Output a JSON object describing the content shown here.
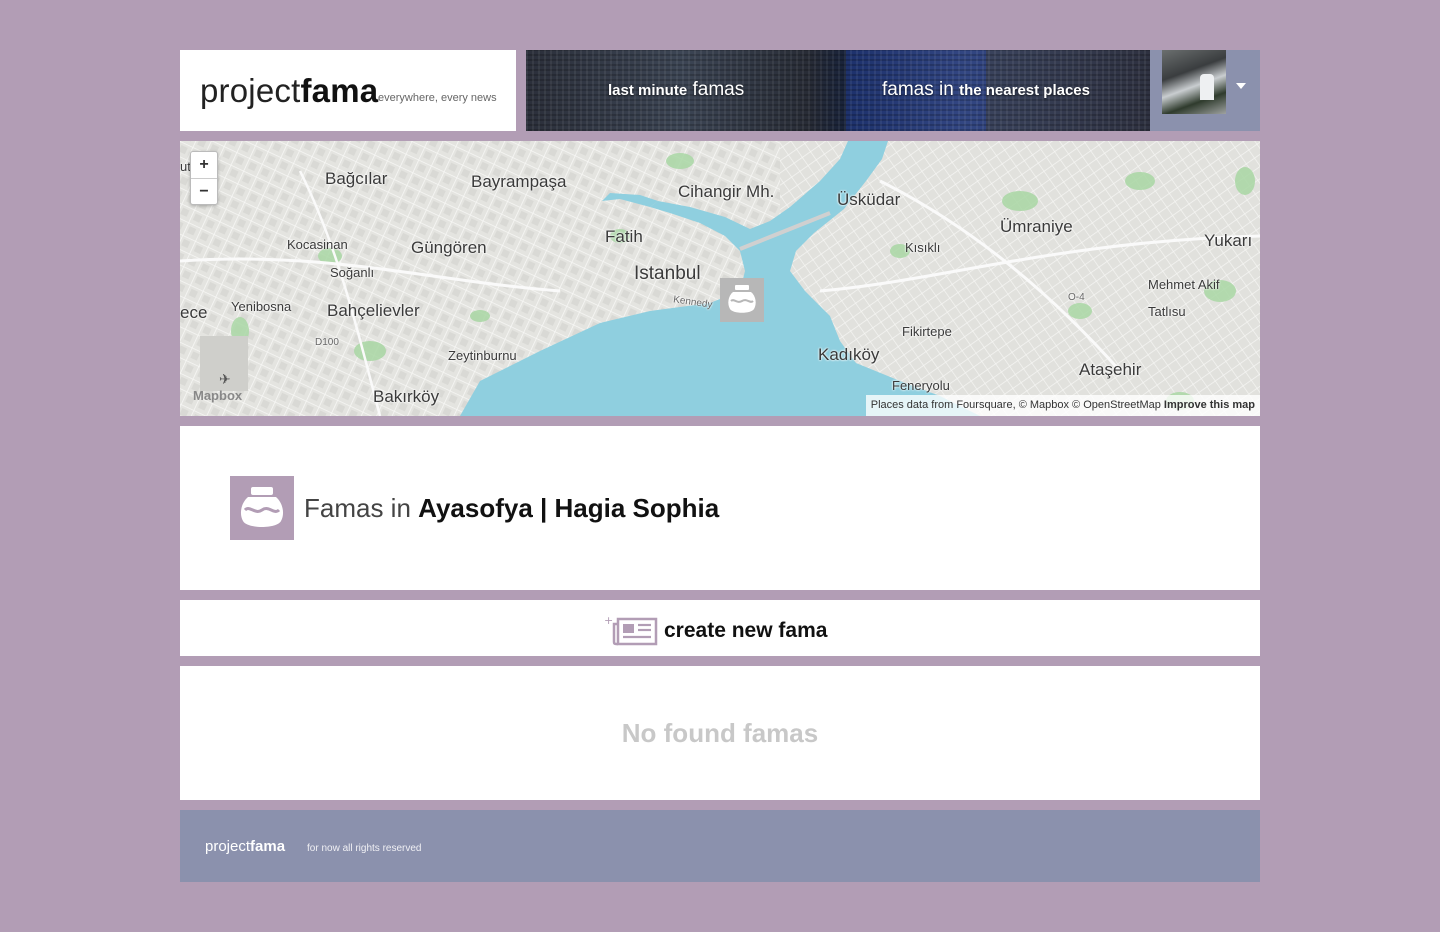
{
  "header": {
    "logo_light": "project",
    "logo_bold": "fama",
    "tagline": "everywhere, every news",
    "nav_last_bold": "last minute",
    "nav_last_light": "famas",
    "nav_nearest_light": "famas in",
    "nav_nearest_bold": "the nearest places"
  },
  "map": {
    "zoom_in": "+",
    "zoom_out": "−",
    "labels": [
      "Bağcılar",
      "Bayrampaşa",
      "Cihangir Mh.",
      "Üsküdar",
      "Ümraniye",
      "Yukarı",
      "Kocasinan",
      "Güngören",
      "Fatih",
      "Kısıklı",
      "Soğanlı",
      "Istanbul",
      "Mehmet Akif",
      "Yenibosna",
      "Bahçelievler",
      "Kennedy",
      "Tatlısu",
      "Fikirtepe",
      "D100",
      "Zeytinburnu",
      "Kadıköy",
      "Ataşehir",
      "Feneryolu",
      "Bakırköy",
      "ece",
      "O-4",
      "ut"
    ],
    "mapbox_logo": "Mapbox",
    "attribution": "Places data from Foursquare, © Mapbox © OpenStreetMap",
    "attribution_link": "Improve this map"
  },
  "place": {
    "prefix": "Famas in",
    "name": "Ayasofya | Hagia Sophia"
  },
  "create": {
    "label": "create new fama"
  },
  "empty": {
    "message": "No found famas"
  },
  "footer": {
    "logo_light": "project",
    "logo_bold": "fama",
    "note": "for now all rights reserved"
  },
  "colors": {
    "background": "#b29db5",
    "panel": "#ffffff",
    "footer": "#8b91ad",
    "water": "#8fcfdf"
  }
}
